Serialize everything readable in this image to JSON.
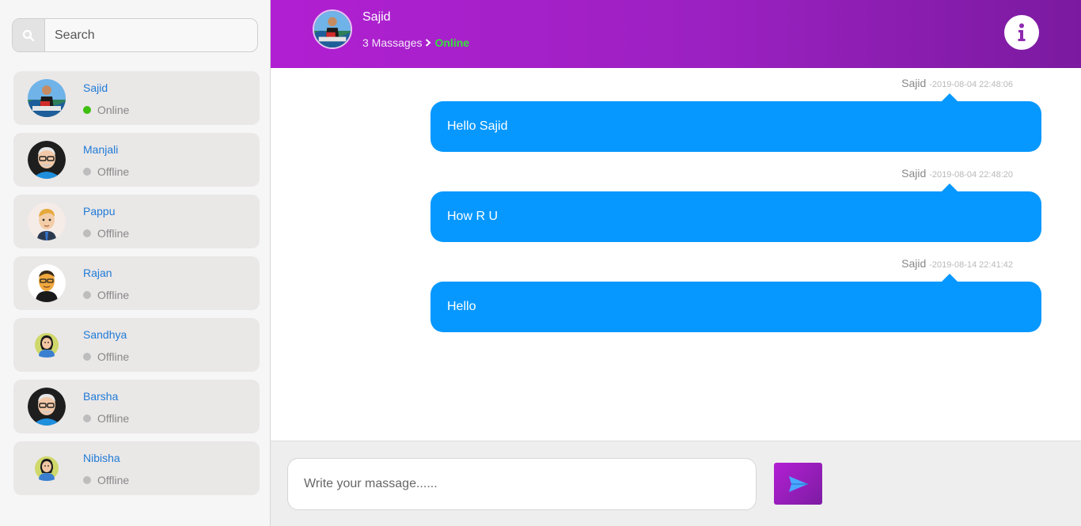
{
  "search": {
    "placeholder": "Search",
    "icon": "search-icon"
  },
  "contacts": [
    {
      "name": "Sajid",
      "status": "Online",
      "status_color": "#3fbf10",
      "avatar": "photo-avatar"
    },
    {
      "name": "Manjali",
      "status": "Offline",
      "status_color": "#bdbdbd",
      "avatar": "old-man-avatar"
    },
    {
      "name": "Pappu",
      "status": "Offline",
      "status_color": "#bdbdbd",
      "avatar": "blond-man-avatar"
    },
    {
      "name": "Rajan",
      "status": "Offline",
      "status_color": "#bdbdbd",
      "avatar": "bald-man-avatar"
    },
    {
      "name": "Sandhya",
      "status": "Offline",
      "status_color": "#bdbdbd",
      "avatar": "woman-avatar"
    },
    {
      "name": "Barsha",
      "status": "Offline",
      "status_color": "#bdbdbd",
      "avatar": "old-man-avatar"
    },
    {
      "name": "Nibisha",
      "status": "Offline",
      "status_color": "#bdbdbd",
      "avatar": "woman-avatar"
    }
  ],
  "header": {
    "name": "Sajid",
    "message_count": "3 Massages",
    "status": "Online",
    "info_icon": "info-icon"
  },
  "messages": [
    {
      "sender": "Sajid",
      "time": "-2019-08-04 22:48:06",
      "text": "Hello Sajid"
    },
    {
      "sender": "Sajid",
      "time": "-2019-08-04 22:48:20",
      "text": "How R U"
    },
    {
      "sender": "Sajid",
      "time": "-2019-08-14 22:41:42",
      "text": "Hello"
    }
  ],
  "composer": {
    "placeholder": "Write your massage......",
    "send_icon": "send-icon"
  },
  "colors": {
    "accent_purple": "#a41fc9",
    "bubble_blue": "#0798ff",
    "online_green": "#36e13a",
    "name_blue": "#1f7bd6"
  }
}
